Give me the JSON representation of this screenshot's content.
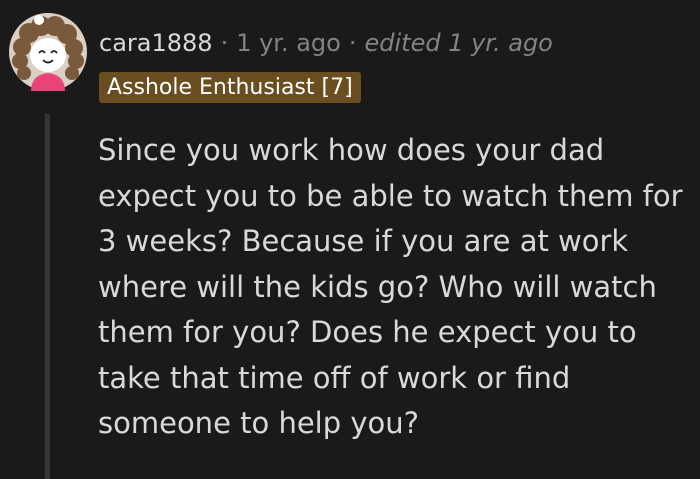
{
  "comment": {
    "username": "cara1888",
    "separator": "·",
    "timestamp": "1 yr. ago",
    "edited": "edited 1 yr. ago",
    "flair": "Asshole Enthusiast [7]",
    "body": "Since you work how does your dad expect you to be able to watch them for 3 weeks? Because if you are at work where will the kids go? Who will watch them for you? Does he expect you to take that time off of work or find someone to help you?"
  },
  "colors": {
    "background": "#1a1a1b",
    "text": "#d7dadc",
    "meta": "#818384",
    "flair_background": "#6a4d20",
    "thread_line": "#343536"
  }
}
